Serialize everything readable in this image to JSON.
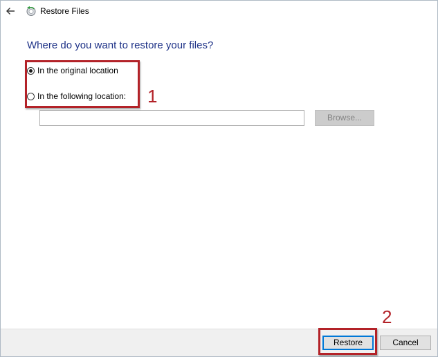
{
  "window": {
    "title": "Restore Files"
  },
  "heading": "Where do you want to restore your files?",
  "options": [
    {
      "label": "In the original location",
      "checked": true
    },
    {
      "label": "In the following location:",
      "checked": false
    }
  ],
  "path_input": {
    "value": "",
    "placeholder": ""
  },
  "browse_label": "Browse...",
  "callouts": {
    "first": "1",
    "second": "2"
  },
  "footer": {
    "restore_label": "Restore",
    "cancel_label": "Cancel"
  },
  "colors": {
    "heading": "#1e3287",
    "callout": "#b32228",
    "focus_border": "#0078d7"
  },
  "icons": {
    "back": "back-arrow-icon",
    "app": "restore-files-icon"
  }
}
